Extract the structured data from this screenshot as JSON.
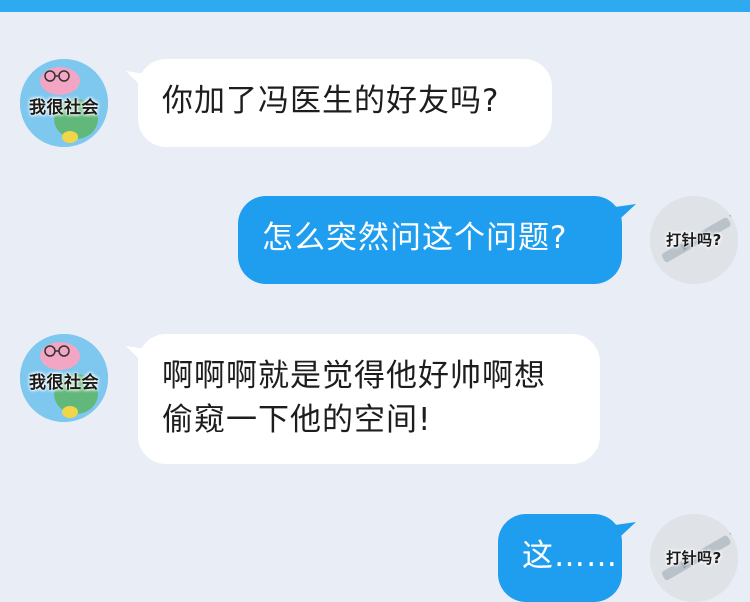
{
  "colors": {
    "background": "#e9edf5",
    "top_bar": "#2eaaf0",
    "left_bubble": "#ffffff",
    "right_bubble": "#1f9ef0"
  },
  "contacts": {
    "friend": {
      "avatar_label": "我很社会",
      "avatar_icon": "pig-character-avatar"
    },
    "me": {
      "avatar_label": "打针吗?",
      "avatar_icon": "syringe-avatar"
    }
  },
  "messages": [
    {
      "side": "left",
      "text": "你加了冯医生的好友吗?"
    },
    {
      "side": "right",
      "text": "怎么突然问这个问题?"
    },
    {
      "side": "left",
      "line1": "啊啊啊就是觉得他好帅啊想",
      "line2": "偷窥一下他的空间!"
    },
    {
      "side": "right",
      "text": "这……"
    }
  ]
}
